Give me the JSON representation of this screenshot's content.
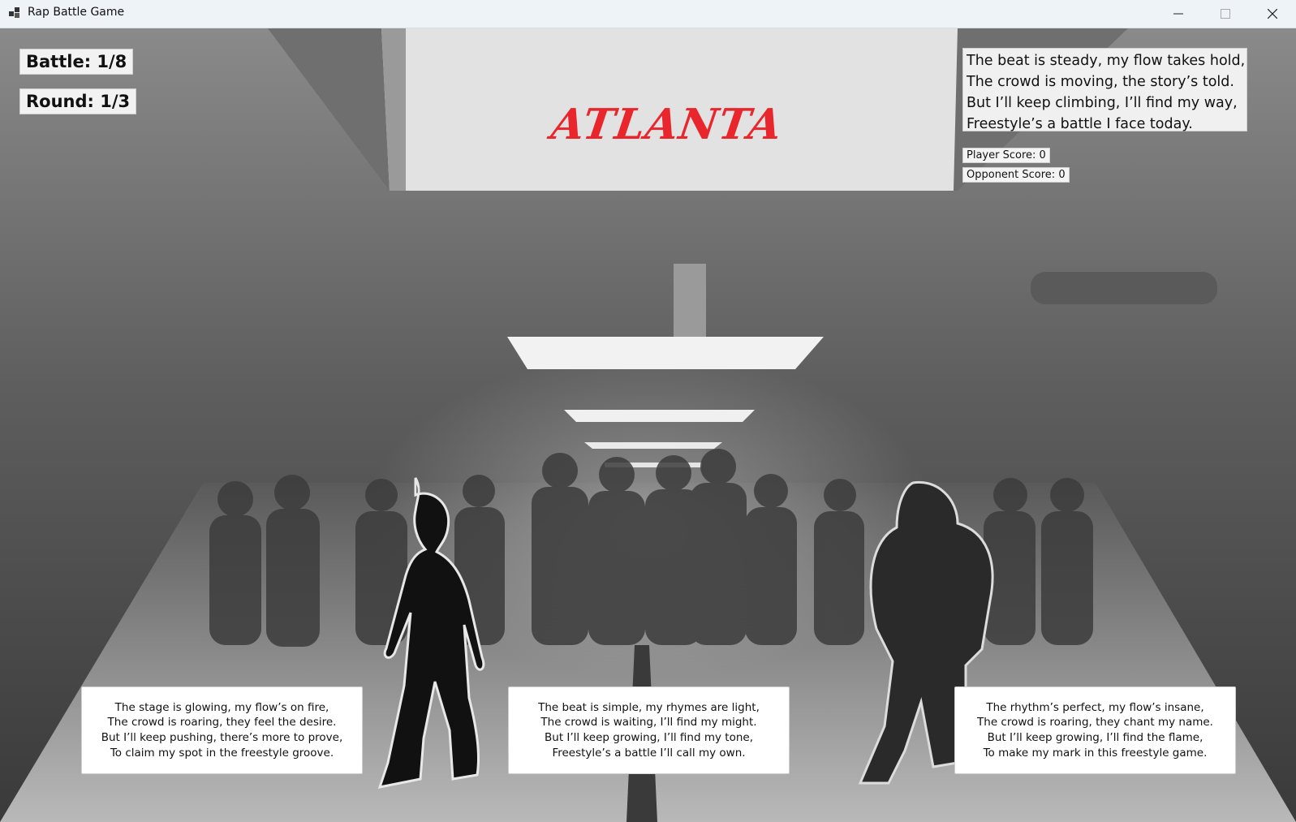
{
  "window": {
    "title": "Rap Battle Game",
    "controls": {
      "minimize": "minimize-icon",
      "maximize": "maximize-icon",
      "close": "close-icon"
    }
  },
  "hud": {
    "battle": "Battle: 1/8",
    "round": "Round: 1/3"
  },
  "city": "ATLANTA",
  "opponent_verse": [
    "The beat is steady, my flow takes hold,",
    "The crowd is moving, the story’s told.",
    "But I’ll keep climbing, I’ll find my way,",
    "Freestyle’s a battle I face today."
  ],
  "scores": {
    "player": "Player Score: 0",
    "opponent": "Opponent Score: 0"
  },
  "options": [
    {
      "lines": [
        "The stage is glowing, my flow’s on fire,",
        "The crowd is roaring, they feel the desire.",
        "But I’ll keep pushing, there’s more to prove,",
        "To claim my spot in the freestyle groove."
      ]
    },
    {
      "lines": [
        "The beat is simple, my rhymes are light,",
        "The crowd is waiting, I’ll find my might.",
        "But I’ll keep growing, I’ll find my tone,",
        "Freestyle’s a battle I’ll call my own."
      ]
    },
    {
      "lines": [
        "The rhythm’s perfect, my flow’s insane,",
        "The crowd is roaring, they chant my name.",
        "But I’ll keep growing, I’ll find the flame,",
        "To make my mark in this freestyle game."
      ]
    }
  ],
  "colors": {
    "city_text": "#e8262c",
    "titlebar": "#eef3f8"
  }
}
